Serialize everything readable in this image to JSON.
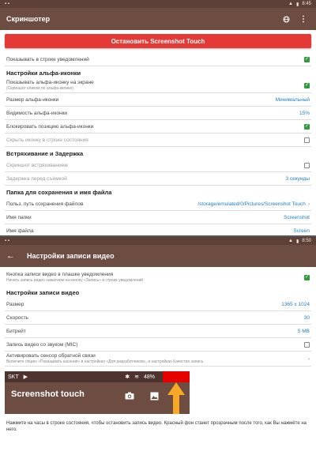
{
  "status_top": {
    "time": "8:45"
  },
  "appbar": {
    "title": "Скриншотер"
  },
  "stop_button": "Остановить Screenshot Touch",
  "rows_top": [
    {
      "label": "Показывать в строке уведомлений",
      "type": "checkbox",
      "checked": true
    }
  ],
  "section_alpha": "Настройки альфа-иконки",
  "alpha_rows": [
    {
      "label": "Показывать альфа-иконку на экране",
      "sub": "(Скриншот кликом по альфа-иконке)",
      "type": "checkbox",
      "checked": true
    },
    {
      "label": "Размер альфа-иконки",
      "type": "value",
      "value": "Минимальный"
    },
    {
      "label": "Видимость альфа-иконки",
      "type": "value",
      "value": "15%"
    },
    {
      "label": "Блокировать позицию альфа-иконки",
      "type": "checkbox",
      "checked": true
    },
    {
      "label": "Скрыть иконку в строке состояния",
      "type": "checkbox",
      "checked": false,
      "disabled": true
    }
  ],
  "section_shake": "Встряхивание и Задержка",
  "shake_rows": [
    {
      "label": "Скриншот встряхиванием",
      "type": "checkbox",
      "checked": false,
      "disabled": true
    },
    {
      "label": "Задержка перед съёмкой",
      "type": "value",
      "value": "3 секунды",
      "disabled": true
    }
  ],
  "section_folder": "Папка для сохранения и имя файла",
  "folder_rows": [
    {
      "label": "Польз. путь сохранения файлов",
      "type": "value",
      "value": "/storage/emulated/0/Pictures/Screenshot Touch",
      "chevron": true
    },
    {
      "label": "Имя папки",
      "type": "value",
      "value": "Screenshot"
    },
    {
      "label": "Имя файла",
      "type": "value",
      "value": "Screen"
    }
  ],
  "status_bottom": {
    "time": "8:50"
  },
  "appbar2": {
    "title": "Настройки записи видео"
  },
  "video_row": {
    "label": "Кнопка записи видео в плашке уведомления",
    "sub": "Начать запись видео нажатием на кнопку «Запись» в строке уведомлений",
    "checked": true
  },
  "section_video": "Настройки записи видео",
  "video_rows": [
    {
      "label": "Размер",
      "type": "value",
      "value": "1365 x 1024"
    },
    {
      "label": "Скорость",
      "type": "value",
      "value": "30"
    },
    {
      "label": "Битрейт",
      "type": "value",
      "value": "5 MB"
    },
    {
      "label": "Запись видео со звуком (MIC)",
      "type": "checkbox",
      "checked": false
    },
    {
      "label": "Активировать сенсор обратной связи",
      "sub": "Включите опцию «Показывать касания» в настройках «Для разработчиков», и настройках Качество запись",
      "type": "chevron"
    }
  ],
  "preview": {
    "carrier": "SKT",
    "battery": "48%",
    "app_title": "Screenshot touch"
  },
  "note": "Нажмите на часы в строке состояния, чтобы остановить запись видео. Красный фон станет прозрачным после того, как Вы нажмёте на него."
}
